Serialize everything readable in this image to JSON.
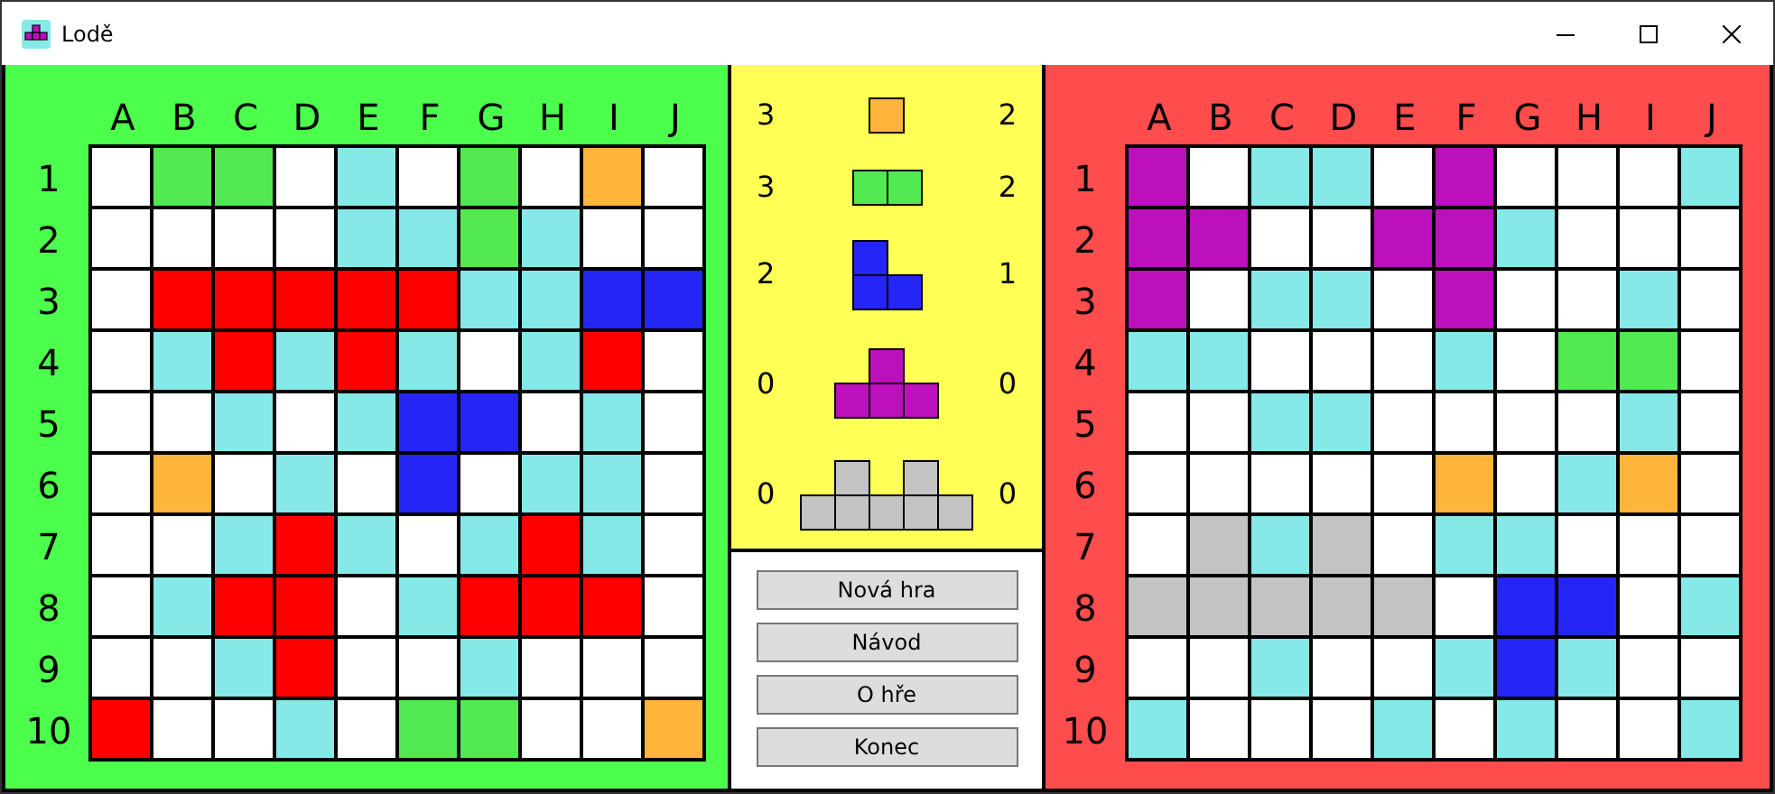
{
  "window": {
    "title": "Lodě"
  },
  "boards": [
    {
      "color": "#4cff4c",
      "columns": [
        "A",
        "B",
        "C",
        "D",
        "E",
        "F",
        "G",
        "H",
        "I",
        "J"
      ],
      "rows": [
        {
          "label": "1",
          "cells": [
            {
              "color": "#ffffff"
            },
            {
              "color": "#52e852"
            },
            {
              "color": "#52e852"
            },
            {
              "color": "#ffffff"
            },
            {
              "color": "#87e8e8"
            },
            {
              "color": "#ffffff"
            },
            {
              "color": "#52e852"
            },
            {
              "color": "#ffffff"
            },
            {
              "color": "#ffb43c"
            },
            {
              "color": "#ffffff"
            }
          ]
        },
        {
          "label": "2",
          "cells": [
            {
              "color": "#ffffff"
            },
            {
              "color": "#ffffff"
            },
            {
              "color": "#ffffff"
            },
            {
              "color": "#ffffff"
            },
            {
              "color": "#87e8e8"
            },
            {
              "color": "#87e8e8"
            },
            {
              "color": "#52e852"
            },
            {
              "color": "#87e8e8"
            },
            {
              "color": "#ffffff"
            },
            {
              "color": "#ffffff"
            }
          ]
        },
        {
          "label": "3",
          "cells": [
            {
              "color": "#ffffff"
            },
            {
              "color": "#ff0000"
            },
            {
              "color": "#ff0000"
            },
            {
              "color": "#ff0000"
            },
            {
              "color": "#ff0000"
            },
            {
              "color": "#ff0000"
            },
            {
              "color": "#87e8e8"
            },
            {
              "color": "#87e8e8"
            },
            {
              "color": "#2525f5"
            },
            {
              "color": "#2525f5"
            }
          ]
        },
        {
          "label": "4",
          "cells": [
            {
              "color": "#ffffff"
            },
            {
              "color": "#87e8e8"
            },
            {
              "color": "#ff0000"
            },
            {
              "color": "#87e8e8"
            },
            {
              "color": "#ff0000"
            },
            {
              "color": "#87e8e8"
            },
            {
              "color": "#ffffff"
            },
            {
              "color": "#87e8e8"
            },
            {
              "color": "#ff0000"
            },
            {
              "color": "#ffffff"
            }
          ]
        },
        {
          "label": "5",
          "cells": [
            {
              "color": "#ffffff"
            },
            {
              "color": "#ffffff"
            },
            {
              "color": "#87e8e8"
            },
            {
              "color": "#ffffff"
            },
            {
              "color": "#87e8e8"
            },
            {
              "color": "#2525f5"
            },
            {
              "color": "#2525f5"
            },
            {
              "color": "#ffffff"
            },
            {
              "color": "#87e8e8"
            },
            {
              "color": "#ffffff"
            }
          ]
        },
        {
          "label": "6",
          "cells": [
            {
              "color": "#ffffff"
            },
            {
              "color": "#ffb43c"
            },
            {
              "color": "#ffffff"
            },
            {
              "color": "#87e8e8"
            },
            {
              "color": "#ffffff"
            },
            {
              "color": "#2525f5"
            },
            {
              "color": "#ffffff"
            },
            {
              "color": "#87e8e8"
            },
            {
              "color": "#87e8e8"
            },
            {
              "color": "#ffffff"
            }
          ]
        },
        {
          "label": "7",
          "cells": [
            {
              "color": "#ffffff"
            },
            {
              "color": "#ffffff"
            },
            {
              "color": "#87e8e8"
            },
            {
              "color": "#ff0000"
            },
            {
              "color": "#87e8e8"
            },
            {
              "color": "#ffffff"
            },
            {
              "color": "#87e8e8"
            },
            {
              "color": "#ff0000"
            },
            {
              "color": "#87e8e8"
            },
            {
              "color": "#ffffff"
            }
          ]
        },
        {
          "label": "8",
          "cells": [
            {
              "color": "#ffffff"
            },
            {
              "color": "#87e8e8"
            },
            {
              "color": "#ff0000"
            },
            {
              "color": "#ff0000"
            },
            {
              "color": "#ffffff"
            },
            {
              "color": "#87e8e8"
            },
            {
              "color": "#ff0000"
            },
            {
              "color": "#ff0000"
            },
            {
              "color": "#ff0000"
            },
            {
              "color": "#ffffff"
            }
          ]
        },
        {
          "label": "9",
          "cells": [
            {
              "color": "#ffffff"
            },
            {
              "color": "#ffffff"
            },
            {
              "color": "#87e8e8"
            },
            {
              "color": "#ff0000"
            },
            {
              "color": "#ffffff"
            },
            {
              "color": "#ffffff"
            },
            {
              "color": "#87e8e8"
            },
            {
              "color": "#ffffff"
            },
            {
              "color": "#ffffff"
            },
            {
              "color": "#ffffff"
            }
          ]
        },
        {
          "label": "10",
          "cells": [
            {
              "color": "#ff0000"
            },
            {
              "color": "#ffffff"
            },
            {
              "color": "#ffffff"
            },
            {
              "color": "#87e8e8"
            },
            {
              "color": "#ffffff"
            },
            {
              "color": "#52e852"
            },
            {
              "color": "#52e852"
            },
            {
              "color": "#ffffff"
            },
            {
              "color": "#ffffff"
            },
            {
              "color": "#ffb43c"
            }
          ]
        }
      ]
    },
    {
      "color": "#ff4c4c",
      "columns": [
        "A",
        "B",
        "C",
        "D",
        "E",
        "F",
        "G",
        "H",
        "I",
        "J"
      ],
      "rows": [
        {
          "label": "1",
          "cells": [
            {
              "color": "#bb10bb"
            },
            {
              "color": "#ffffff"
            },
            {
              "color": "#87e8e8"
            },
            {
              "color": "#87e8e8"
            },
            {
              "color": "#ffffff"
            },
            {
              "color": "#bb10bb"
            },
            {
              "color": "#ffffff"
            },
            {
              "color": "#ffffff"
            },
            {
              "color": "#ffffff"
            },
            {
              "color": "#87e8e8"
            }
          ]
        },
        {
          "label": "2",
          "cells": [
            {
              "color": "#bb10bb"
            },
            {
              "color": "#bb10bb"
            },
            {
              "color": "#ffffff"
            },
            {
              "color": "#ffffff"
            },
            {
              "color": "#bb10bb"
            },
            {
              "color": "#bb10bb"
            },
            {
              "color": "#87e8e8"
            },
            {
              "color": "#ffffff"
            },
            {
              "color": "#ffffff"
            },
            {
              "color": "#ffffff"
            }
          ]
        },
        {
          "label": "3",
          "cells": [
            {
              "color": "#bb10bb"
            },
            {
              "color": "#ffffff"
            },
            {
              "color": "#87e8e8"
            },
            {
              "color": "#87e8e8"
            },
            {
              "color": "#ffffff"
            },
            {
              "color": "#bb10bb"
            },
            {
              "color": "#ffffff"
            },
            {
              "color": "#ffffff"
            },
            {
              "color": "#87e8e8"
            },
            {
              "color": "#ffffff"
            }
          ]
        },
        {
          "label": "4",
          "cells": [
            {
              "color": "#87e8e8"
            },
            {
              "color": "#87e8e8"
            },
            {
              "color": "#ffffff"
            },
            {
              "color": "#ffffff"
            },
            {
              "color": "#ffffff"
            },
            {
              "color": "#87e8e8"
            },
            {
              "color": "#ffffff"
            },
            {
              "color": "#52e852"
            },
            {
              "color": "#52e852"
            },
            {
              "color": "#ffffff"
            }
          ]
        },
        {
          "label": "5",
          "cells": [
            {
              "color": "#ffffff"
            },
            {
              "color": "#ffffff"
            },
            {
              "color": "#87e8e8"
            },
            {
              "color": "#87e8e8"
            },
            {
              "color": "#ffffff"
            },
            {
              "color": "#ffffff"
            },
            {
              "color": "#ffffff"
            },
            {
              "color": "#ffffff"
            },
            {
              "color": "#87e8e8"
            },
            {
              "color": "#ffffff"
            }
          ]
        },
        {
          "label": "6",
          "cells": [
            {
              "color": "#ffffff"
            },
            {
              "color": "#ffffff"
            },
            {
              "color": "#ffffff"
            },
            {
              "color": "#ffffff"
            },
            {
              "color": "#ffffff"
            },
            {
              "color": "#ffb43c"
            },
            {
              "color": "#ffffff"
            },
            {
              "color": "#87e8e8"
            },
            {
              "color": "#ffb43c"
            },
            {
              "color": "#ffffff"
            }
          ]
        },
        {
          "label": "7",
          "cells": [
            {
              "color": "#ffffff"
            },
            {
              "color": "#c3c3c3"
            },
            {
              "color": "#87e8e8"
            },
            {
              "color": "#c3c3c3"
            },
            {
              "color": "#ffffff"
            },
            {
              "color": "#87e8e8"
            },
            {
              "color": "#87e8e8"
            },
            {
              "color": "#ffffff"
            },
            {
              "color": "#ffffff"
            },
            {
              "color": "#ffffff"
            }
          ]
        },
        {
          "label": "8",
          "cells": [
            {
              "color": "#c3c3c3"
            },
            {
              "color": "#c3c3c3"
            },
            {
              "color": "#c3c3c3"
            },
            {
              "color": "#c3c3c3"
            },
            {
              "color": "#c3c3c3"
            },
            {
              "color": "#ffffff"
            },
            {
              "color": "#2525f5"
            },
            {
              "color": "#2525f5"
            },
            {
              "color": "#ffffff"
            },
            {
              "color": "#87e8e8"
            }
          ]
        },
        {
          "label": "9",
          "cells": [
            {
              "color": "#ffffff"
            },
            {
              "color": "#ffffff"
            },
            {
              "color": "#87e8e8"
            },
            {
              "color": "#ffffff"
            },
            {
              "color": "#ffffff"
            },
            {
              "color": "#87e8e8"
            },
            {
              "color": "#2525f5"
            },
            {
              "color": "#87e8e8"
            },
            {
              "color": "#ffffff"
            },
            {
              "color": "#ffffff"
            }
          ]
        },
        {
          "label": "10",
          "cells": [
            {
              "color": "#87e8e8"
            },
            {
              "color": "#ffffff"
            },
            {
              "color": "#ffffff"
            },
            {
              "color": "#ffffff"
            },
            {
              "color": "#87e8e8"
            },
            {
              "color": "#ffffff"
            },
            {
              "color": "#87e8e8"
            },
            {
              "color": "#ffffff"
            },
            {
              "color": "#ffffff"
            },
            {
              "color": "#87e8e8"
            }
          ]
        }
      ]
    }
  ],
  "ships": [
    {
      "kind": "single",
      "color": "#ffb43c",
      "left_count": "3",
      "right_count": "2"
    },
    {
      "kind": "double",
      "color": "#52e852",
      "left_count": "3",
      "right_count": "2"
    },
    {
      "kind": "corner",
      "color": "#2525f5",
      "left_count": "2",
      "right_count": "1"
    },
    {
      "kind": "tee",
      "color": "#bb10bb",
      "left_count": "0",
      "right_count": "0"
    },
    {
      "kind": "bridge",
      "color": "#c3c3c3",
      "left_count": "0",
      "right_count": "0"
    }
  ],
  "buttons": [
    "Nová hra",
    "Návod",
    "O hře",
    "Konec"
  ]
}
